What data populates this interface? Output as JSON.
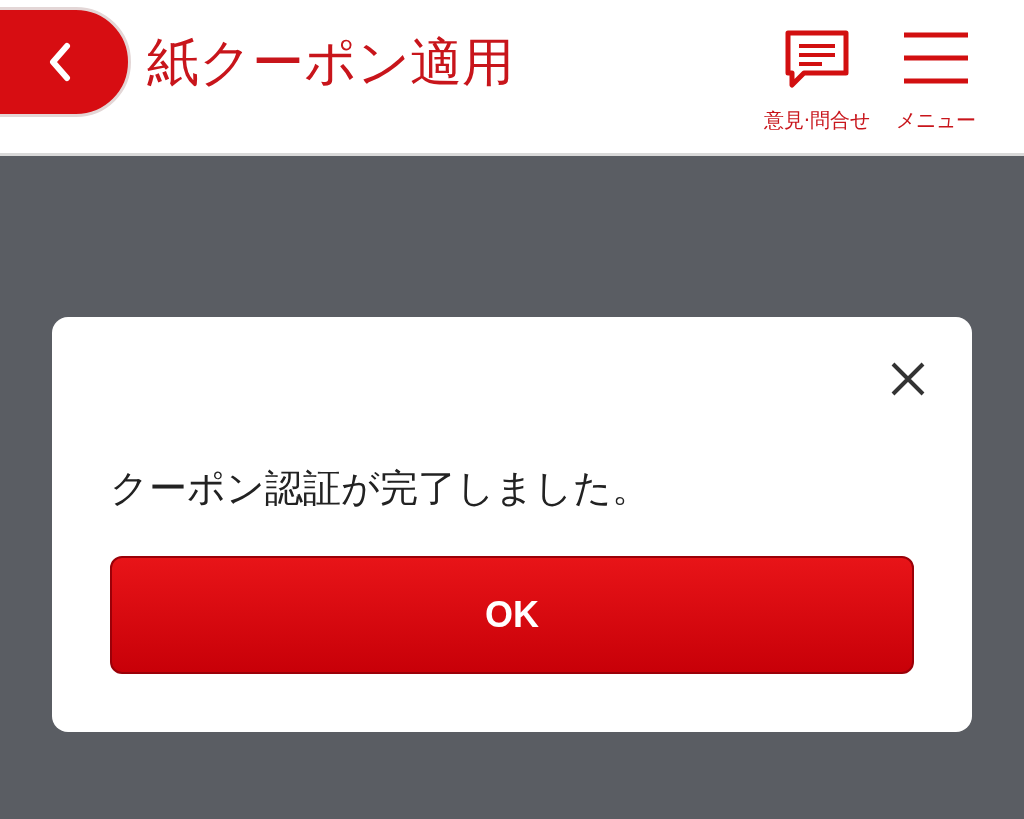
{
  "header": {
    "title": "紙クーポン適用",
    "actions": [
      {
        "kind": "feedback",
        "label": "意見·問合せ"
      },
      {
        "kind": "menu",
        "label": "メニュー"
      }
    ]
  },
  "dialog": {
    "message": "クーポン認証が完了しました。",
    "button": "OK"
  }
}
